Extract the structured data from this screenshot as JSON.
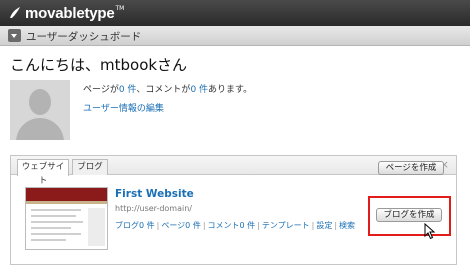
{
  "app": {
    "logo_text": "movabletype",
    "logo_tm": "TM"
  },
  "header": {
    "title": "ユーザーダッシュボード"
  },
  "greeting": "こんにちは、mtbookさん",
  "stats": {
    "prefix": "ページが",
    "pages": "0 件",
    "middle": "、コメントが",
    "comments": "0 件",
    "suffix": "あります。"
  },
  "edit_profile_link": "ユーザー情報の編集",
  "panel": {
    "tabs": [
      {
        "label": "ウェブサイト",
        "active": true
      },
      {
        "label": "ブログ",
        "active": false
      }
    ],
    "close_label": "×",
    "website": {
      "title": "First Website",
      "url": "http://user-domain/",
      "links": [
        "ブログ0 件",
        "ページ0 件",
        "コメント0 件",
        "テンプレート",
        "設定",
        "検索"
      ],
      "create_page_button": "ページを作成",
      "create_blog_button": "ブログを作成"
    }
  },
  "colors": {
    "link": "#1a6fb5",
    "highlight": "#e21b1b",
    "topbar": "#333333"
  }
}
